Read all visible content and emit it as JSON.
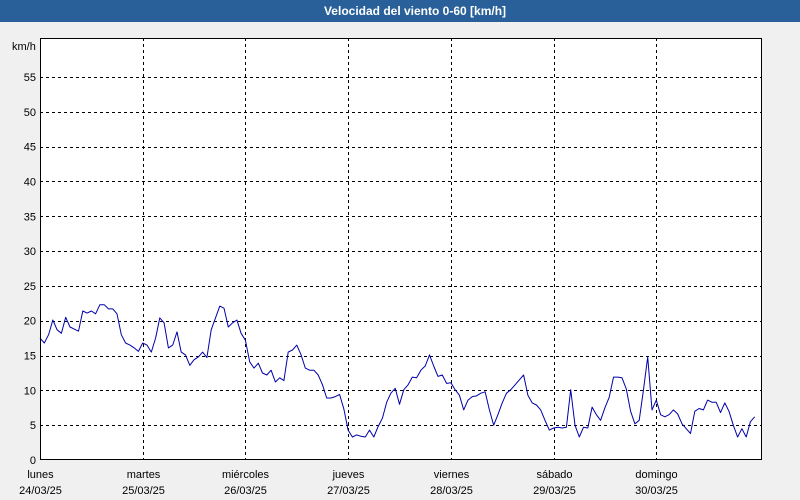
{
  "colors": {
    "title_bar": "#2a6099",
    "title_text": "#ffffff",
    "background": "#f0f0f0",
    "plot_background": "#ffffff",
    "grid": "#000000",
    "frame": "#000000"
  },
  "chart_data": {
    "type": "line",
    "title": "Velocidad del viento 0-60 [km/h]",
    "ylabel": "km/h",
    "xlabel": "",
    "ylim": [
      0,
      60
    ],
    "yticks": [
      0,
      5,
      10,
      15,
      20,
      25,
      30,
      35,
      40,
      45,
      50,
      55
    ],
    "xlim": [
      "24/03/25 00:00",
      "31/03/25 00:00"
    ],
    "xticks": [
      {
        "day": "lunes",
        "date": "24/03/25"
      },
      {
        "day": "martes",
        "date": "25/03/25"
      },
      {
        "day": "miércoles",
        "date": "26/03/25"
      },
      {
        "day": "jueves",
        "date": "27/03/25"
      },
      {
        "day": "viernes",
        "date": "28/03/25"
      },
      {
        "day": "sábado",
        "date": "29/03/25"
      },
      {
        "day": "domingo",
        "date": "30/03/25"
      }
    ],
    "grid": true,
    "legend": "none",
    "series": [
      {
        "color": "#0000aa",
        "x": [
          "24/03/25 00:00",
          "24/03/25 01:00",
          "24/03/25 02:00",
          "24/03/25 03:00",
          "24/03/25 04:00",
          "24/03/25 05:00",
          "24/03/25 06:00",
          "24/03/25 07:00",
          "24/03/25 08:00",
          "24/03/25 09:00",
          "24/03/25 10:00",
          "24/03/25 11:00",
          "24/03/25 12:00",
          "24/03/25 13:00",
          "24/03/25 14:00",
          "24/03/25 15:00",
          "24/03/25 16:00",
          "24/03/25 17:00",
          "24/03/25 18:00",
          "24/03/25 19:00",
          "24/03/25 20:00",
          "24/03/25 21:00",
          "24/03/25 22:00",
          "24/03/25 23:00",
          "25/03/25 00:00",
          "25/03/25 01:00",
          "25/03/25 02:00",
          "25/03/25 03:00",
          "25/03/25 04:00",
          "25/03/25 05:00",
          "25/03/25 06:00",
          "25/03/25 07:00",
          "25/03/25 08:00",
          "25/03/25 09:00",
          "25/03/25 10:00",
          "25/03/25 11:00",
          "25/03/25 12:00",
          "25/03/25 13:00",
          "25/03/25 14:00",
          "25/03/25 15:00",
          "25/03/25 16:00",
          "25/03/25 17:00",
          "25/03/25 18:00",
          "25/03/25 19:00",
          "25/03/25 20:00",
          "25/03/25 21:00",
          "25/03/25 22:00",
          "25/03/25 23:00",
          "26/03/25 00:00",
          "26/03/25 01:00",
          "26/03/25 02:00",
          "26/03/25 03:00",
          "26/03/25 04:00",
          "26/03/25 05:00",
          "26/03/25 06:00",
          "26/03/25 07:00",
          "26/03/25 08:00",
          "26/03/25 09:00",
          "26/03/25 10:00",
          "26/03/25 11:00",
          "26/03/25 12:00",
          "26/03/25 13:00",
          "26/03/25 14:00",
          "26/03/25 15:00",
          "26/03/25 16:00",
          "26/03/25 17:00",
          "26/03/25 18:00",
          "26/03/25 19:00",
          "26/03/25 20:00",
          "26/03/25 21:00",
          "26/03/25 22:00",
          "26/03/25 23:00",
          "27/03/25 00:00",
          "27/03/25 01:00",
          "27/03/25 02:00",
          "27/03/25 03:00",
          "27/03/25 04:00",
          "27/03/25 05:00",
          "27/03/25 06:00",
          "27/03/25 07:00",
          "27/03/25 08:00",
          "27/03/25 09:00",
          "27/03/25 10:00",
          "27/03/25 11:00",
          "27/03/25 12:00",
          "27/03/25 13:00",
          "27/03/25 14:00",
          "27/03/25 15:00",
          "27/03/25 16:00",
          "27/03/25 17:00",
          "27/03/25 18:00",
          "27/03/25 19:00",
          "27/03/25 20:00",
          "27/03/25 21:00",
          "27/03/25 22:00",
          "27/03/25 23:00",
          "28/03/25 00:00",
          "28/03/25 01:00",
          "28/03/25 02:00",
          "28/03/25 03:00",
          "28/03/25 04:00",
          "28/03/25 05:00",
          "28/03/25 06:00",
          "28/03/25 07:00",
          "28/03/25 08:00",
          "28/03/25 09:00",
          "28/03/25 10:00",
          "28/03/25 11:00",
          "28/03/25 12:00",
          "28/03/25 13:00",
          "28/03/25 14:00",
          "28/03/25 15:00",
          "28/03/25 16:00",
          "28/03/25 17:00",
          "28/03/25 18:00",
          "28/03/25 19:00",
          "28/03/25 20:00",
          "28/03/25 21:00",
          "28/03/25 22:00",
          "28/03/25 23:00",
          "29/03/25 00:00",
          "29/03/25 01:00",
          "29/03/25 02:00",
          "29/03/25 03:00",
          "29/03/25 04:00",
          "29/03/25 05:00",
          "29/03/25 06:00",
          "29/03/25 07:00",
          "29/03/25 08:00",
          "29/03/25 09:00",
          "29/03/25 10:00",
          "29/03/25 11:00",
          "29/03/25 12:00",
          "29/03/25 13:00",
          "29/03/25 14:00",
          "29/03/25 15:00",
          "29/03/25 16:00",
          "29/03/25 17:00",
          "29/03/25 18:00",
          "29/03/25 19:00",
          "29/03/25 20:00",
          "29/03/25 21:00",
          "29/03/25 22:00",
          "29/03/25 23:00",
          "30/03/25 00:00",
          "30/03/25 01:00",
          "30/03/25 02:00",
          "30/03/25 03:00",
          "30/03/25 04:00",
          "30/03/25 05:00",
          "30/03/25 06:00",
          "30/03/25 07:00",
          "30/03/25 08:00",
          "30/03/25 09:00",
          "30/03/25 10:00",
          "30/03/25 11:00",
          "30/03/25 12:00",
          "30/03/25 13:00",
          "30/03/25 14:00",
          "30/03/25 15:00",
          "30/03/25 16:00",
          "30/03/25 17:00",
          "30/03/25 18:00",
          "30/03/25 19:00",
          "30/03/25 20:00",
          "30/03/25 21:00",
          "30/03/25 22:00",
          "30/03/25 23:00"
        ],
        "values": [
          17.5,
          16.8,
          18.0,
          20.1,
          18.7,
          18.2,
          20.5,
          19.1,
          18.8,
          18.5,
          21.4,
          21.1,
          21.4,
          21.0,
          22.3,
          22.3,
          21.7,
          21.7,
          21.0,
          18.0,
          16.8,
          16.5,
          16.1,
          15.6,
          16.8,
          16.5,
          15.5,
          17.5,
          20.4,
          19.7,
          16.1,
          16.5,
          18.4,
          15.5,
          15.1,
          13.6,
          14.4,
          14.8,
          15.5,
          14.7,
          18.7,
          20.4,
          22.1,
          21.8,
          19.1,
          19.7,
          20.1,
          18.2,
          17.2,
          14.1,
          13.2,
          13.9,
          12.5,
          12.2,
          12.9,
          11.2,
          11.8,
          11.4,
          15.5,
          15.8,
          16.5,
          15.1,
          13.2,
          12.9,
          12.9,
          12.2,
          10.8,
          8.9,
          8.9,
          9.1,
          9.4,
          7.3,
          4.3,
          3.3,
          3.6,
          3.4,
          3.3,
          4.3,
          3.3,
          4.8,
          6.0,
          8.3,
          9.6,
          10.3,
          8.0,
          10.1,
          10.8,
          11.9,
          11.8,
          12.9,
          13.5,
          15.1,
          13.5,
          12.0,
          12.2,
          11.0,
          11.1,
          10.1,
          9.3,
          7.2,
          8.6,
          9.1,
          9.2,
          9.6,
          9.8,
          7.2,
          5.0,
          6.5,
          8.2,
          9.6,
          10.1,
          10.8,
          11.5,
          12.2,
          9.3,
          8.2,
          7.9,
          7.2,
          5.7,
          4.3,
          4.6,
          4.7,
          4.6,
          4.7,
          10.1,
          5.0,
          3.3,
          4.7,
          4.6,
          7.6,
          6.5,
          5.7,
          7.5,
          9.0,
          11.9,
          11.9,
          11.8,
          10.2,
          7.0,
          5.2,
          5.7,
          10.0,
          14.8,
          7.2,
          8.6,
          6.5,
          6.2,
          6.5,
          7.2,
          6.6,
          5.2,
          4.5,
          3.8,
          7.0,
          7.4,
          7.2,
          8.6,
          8.3,
          8.3,
          6.8,
          8.2,
          7.0,
          5.0,
          3.3,
          4.5,
          3.3,
          5.5,
          6.2
        ]
      }
    ]
  }
}
